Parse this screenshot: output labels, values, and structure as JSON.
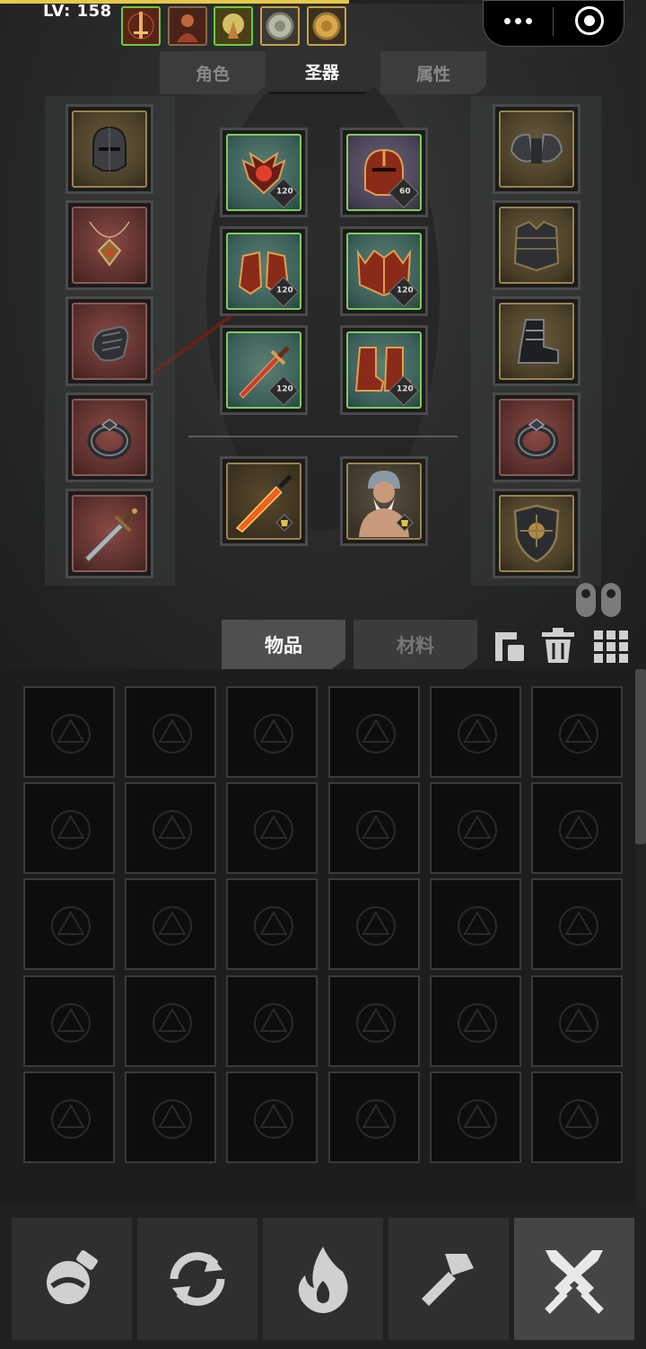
{
  "status": {
    "level_text": "LV: 158",
    "xp_progress": 0.54
  },
  "mini_program_capsule": {
    "more_icon": "more-dots-icon",
    "close_icon": "target-close-icon"
  },
  "buffs": [
    "sword-buff-icon",
    "warrior-buff-icon",
    "holy-light-buff-icon",
    "silver-coin-buff-icon",
    "gold-coin-buff-icon"
  ],
  "top_tabs": [
    {
      "label": "角色",
      "active": false
    },
    {
      "label": "圣器",
      "active": true
    },
    {
      "label": "属性",
      "active": false
    }
  ],
  "left_equipment": [
    {
      "name": "iron-helmet-icon",
      "rarity": "gold"
    },
    {
      "name": "amulet-icon",
      "rarity": "red"
    },
    {
      "name": "gauntlet-icon",
      "rarity": "red"
    },
    {
      "name": "ring-icon",
      "rarity": "red"
    },
    {
      "name": "sword-icon",
      "rarity": "red"
    }
  ],
  "right_equipment": [
    {
      "name": "shoulder-armor-icon",
      "rarity": "gold"
    },
    {
      "name": "chest-armor-icon",
      "rarity": "gold"
    },
    {
      "name": "boots-icon",
      "rarity": "gold"
    },
    {
      "name": "ring-icon",
      "rarity": "red"
    },
    {
      "name": "shield-icon",
      "rarity": "gold"
    }
  ],
  "artifacts": [
    {
      "name": "demon-amulet-icon",
      "level": "120",
      "rarity": "green"
    },
    {
      "name": "dragon-helmet-icon",
      "level": "60",
      "rarity": "purple"
    },
    {
      "name": "dragon-gloves-icon",
      "level": "120",
      "rarity": "green"
    },
    {
      "name": "dragon-armor-icon",
      "level": "120",
      "rarity": "green"
    },
    {
      "name": "flame-blade-icon",
      "level": "120",
      "rarity": "green"
    },
    {
      "name": "dragon-boots-icon",
      "level": "120",
      "rarity": "green"
    }
  ],
  "special_slots": [
    {
      "name": "fire-sword-icon"
    },
    {
      "name": "viking-warrior-icon"
    }
  ],
  "bag_tabs": [
    {
      "label": "物品",
      "active": true
    },
    {
      "label": "材料",
      "active": false
    }
  ],
  "bag_tools": [
    "sort-icon",
    "trash-icon",
    "grid-icon"
  ],
  "inventory": {
    "rows": 5,
    "cols": 6,
    "empty_icon": "empty-slot-triangle-icon"
  },
  "bottom_nav": [
    {
      "name": "potion-icon",
      "active": false
    },
    {
      "name": "refresh-icon",
      "active": false
    },
    {
      "name": "fire-icon",
      "active": false
    },
    {
      "name": "hammer-icon",
      "active": false
    },
    {
      "name": "crossed-swords-icon",
      "active": true
    }
  ],
  "colors": {
    "accent_gold": "#c9a24a",
    "rarity_green": "#7fcc5a",
    "rarity_red": "#8a4a45",
    "xp": "#e6c84a"
  }
}
